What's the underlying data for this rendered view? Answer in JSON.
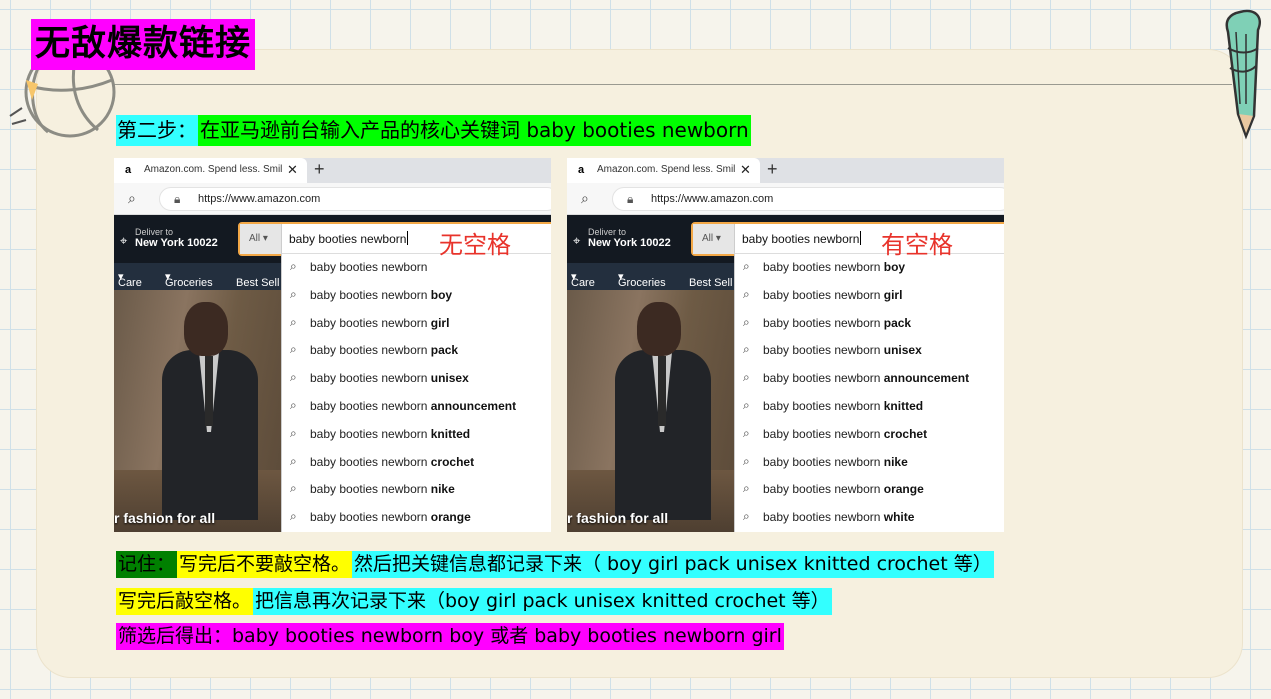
{
  "page": {
    "title": "无敌爆款链接",
    "step": {
      "lead": "第二步：",
      "rest": "在亚马逊前台输入产品的核心关键词  baby booties newborn"
    }
  },
  "colors": {
    "magenta": "#ff00ff",
    "cyan": "#33ffff",
    "green": "#00ff00",
    "yellow": "#ffff00",
    "dark_green": "#008000",
    "annotation_red": "#e8332b"
  },
  "browser": {
    "tab_title": "Amazon.com. Spend less. Smile more.",
    "url": "https://www.amazon.com",
    "deliver_line1": "Deliver to",
    "deliver_line2": "New York 10022",
    "search_dept": "All",
    "query": "baby booties newborn",
    "nav_items": [
      "Care",
      "Groceries",
      "Best Sell"
    ],
    "hero_text": "r fashion for all"
  },
  "screenshots": [
    {
      "annotation": "无空格",
      "suggestions": [
        {
          "base": "baby booties newborn",
          "bold": ""
        },
        {
          "base": "baby booties newborn ",
          "bold": "boy"
        },
        {
          "base": "baby booties newborn ",
          "bold": "girl"
        },
        {
          "base": "baby booties newborn ",
          "bold": "pack"
        },
        {
          "base": "baby booties newborn ",
          "bold": "unisex"
        },
        {
          "base": "baby booties newborn ",
          "bold": "announcement"
        },
        {
          "base": "baby booties newborn ",
          "bold": "knitted"
        },
        {
          "base": "baby booties newborn ",
          "bold": "crochet"
        },
        {
          "base": "baby booties newborn ",
          "bold": "nike"
        },
        {
          "base": "baby booties newborn ",
          "bold": "orange"
        }
      ]
    },
    {
      "annotation": "有空格",
      "suggestions": [
        {
          "base": "baby booties newborn ",
          "bold": "boy"
        },
        {
          "base": "baby booties newborn ",
          "bold": "girl"
        },
        {
          "base": "baby booties newborn ",
          "bold": "pack"
        },
        {
          "base": "baby booties newborn ",
          "bold": "unisex"
        },
        {
          "base": "baby booties newborn ",
          "bold": "announcement"
        },
        {
          "base": "baby booties newborn ",
          "bold": "knitted"
        },
        {
          "base": "baby booties newborn ",
          "bold": "crochet"
        },
        {
          "base": "baby booties newborn ",
          "bold": "nike"
        },
        {
          "base": "baby booties newborn ",
          "bold": "orange"
        },
        {
          "base": "baby booties newborn ",
          "bold": "white"
        }
      ]
    }
  ],
  "notes": [
    {
      "segments": [
        {
          "text": "记住：",
          "bg": "#008000"
        },
        {
          "text": "写完后不要敲空格。",
          "bg": "#ffff00"
        },
        {
          "text": "然后把关键信息都记录下来（ boy girl pack unisex knitted crochet 等）",
          "bg": "#33ffff"
        }
      ]
    },
    {
      "segments": [
        {
          "text": "写完后敲空格。",
          "bg": "#ffff00"
        },
        {
          "text": "把信息再次记录下来（boy girl pack unisex knitted crochet 等）",
          "bg": "#33ffff"
        }
      ]
    },
    {
      "segments": [
        {
          "text": "筛选后得出：baby booties newborn boy 或者 baby booties newborn girl",
          "bg": "#ff00ff"
        }
      ]
    }
  ]
}
